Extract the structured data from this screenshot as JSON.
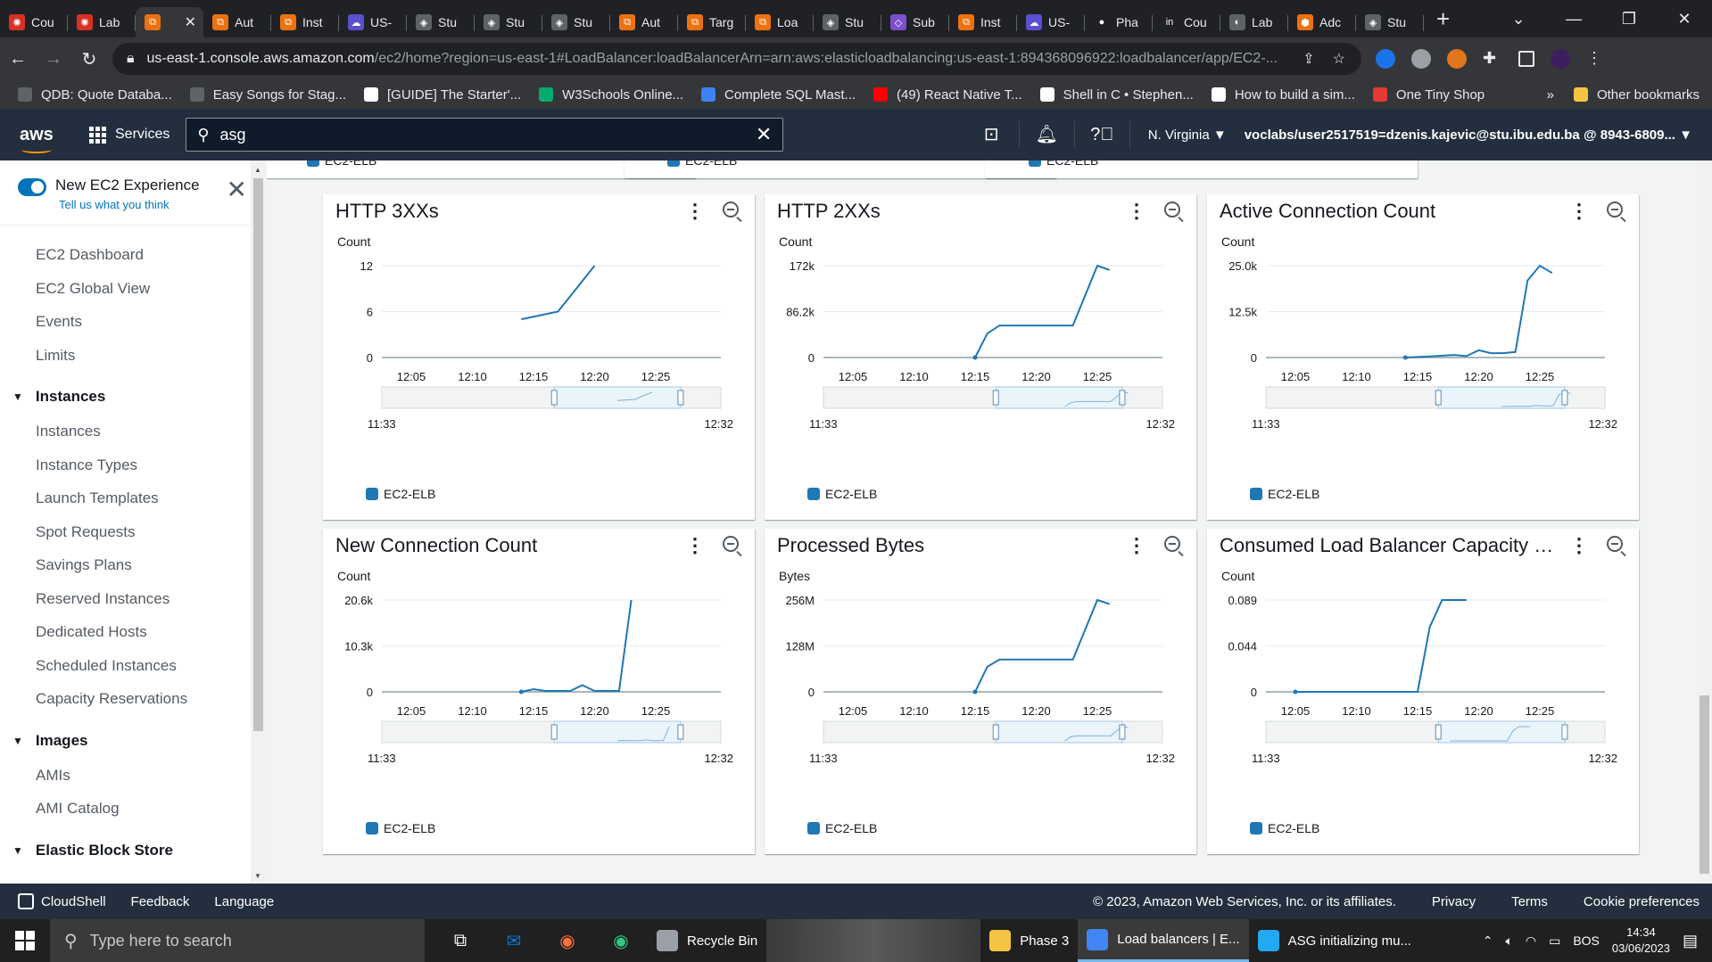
{
  "browser": {
    "tabs": [
      {
        "label": "Cou",
        "color": "#d93025",
        "glyph": "✺"
      },
      {
        "label": "Lab",
        "color": "#d93025",
        "glyph": "✺"
      },
      {
        "label": "",
        "color": "#ec7211",
        "glyph": "⧉",
        "active": true
      },
      {
        "label": "Aut",
        "color": "#ec7211",
        "glyph": "⧉"
      },
      {
        "label": "Inst",
        "color": "#ec7211",
        "glyph": "⧉"
      },
      {
        "label": "US-",
        "color": "#5a4fcf",
        "glyph": "☁"
      },
      {
        "label": "Stu",
        "color": "#5f6368",
        "glyph": "◈"
      },
      {
        "label": "Stu",
        "color": "#5f6368",
        "glyph": "◈"
      },
      {
        "label": "Stu",
        "color": "#5f6368",
        "glyph": "◈"
      },
      {
        "label": "Aut",
        "color": "#ec7211",
        "glyph": "⧉"
      },
      {
        "label": "Targ",
        "color": "#ec7211",
        "glyph": "⧉"
      },
      {
        "label": "Loa",
        "color": "#ec7211",
        "glyph": "⧉"
      },
      {
        "label": "Stu",
        "color": "#5f6368",
        "glyph": "◈"
      },
      {
        "label": "Sub",
        "color": "#7b4fcf",
        "glyph": "◇"
      },
      {
        "label": "Inst",
        "color": "#ec7211",
        "glyph": "⧉"
      },
      {
        "label": "US-",
        "color": "#5a4fcf",
        "glyph": "☁"
      },
      {
        "label": "Pha",
        "color": "#202124",
        "glyph": "●"
      },
      {
        "label": "Cou",
        "color": "#202124",
        "glyph": "in"
      },
      {
        "label": "Lab",
        "color": "#5f6368",
        "glyph": "◐"
      },
      {
        "label": "Adc",
        "color": "#ec7211",
        "glyph": "⬢"
      },
      {
        "label": "Stu",
        "color": "#5f6368",
        "glyph": "◈"
      }
    ],
    "url_host": "us-east-1.console.aws.amazon.com",
    "url_rest": "/ec2/home?region=us-east-1#LoadBalancer:loadBalancerArn=arn:aws:elasticloadbalancing:us-east-1:894368096922:loadbalancer/app/EC2-...",
    "bookmarks": [
      {
        "label": "QDB: Quote Databa...",
        "color": "#5f6368"
      },
      {
        "label": "Easy Songs for Stag...",
        "color": "#5f6368"
      },
      {
        "label": "[GUIDE] The Starter'...",
        "color": "#ffffff"
      },
      {
        "label": "W3Schools Online...",
        "color": "#04aa6d"
      },
      {
        "label": "Complete SQL Mast...",
        "color": "#3b82f6"
      },
      {
        "label": "(49) React Native T...",
        "color": "#ff0000"
      },
      {
        "label": "Shell in C • Stephen...",
        "color": "#ffffff"
      },
      {
        "label": "How to build a sim...",
        "color": "#ffffff"
      },
      {
        "label": "One Tiny Shop",
        "color": "#e53935"
      }
    ],
    "bookmarks_more": "»",
    "other_bookmarks": "Other bookmarks"
  },
  "aws": {
    "logo": "aws",
    "services_label": "Services",
    "search_value": "asg",
    "region": "N. Virginia",
    "account": "voclabs/user2517519=dzenis.kajevic@stu.ibu.edu.ba @ 8943-6809...",
    "accent": "#ff9900"
  },
  "sidebar": {
    "new_exp_title": "New EC2 Experience",
    "new_exp_link": "Tell us what you think",
    "top_items": [
      "EC2 Dashboard",
      "EC2 Global View",
      "Events",
      "Limits"
    ],
    "instances_section": "Instances",
    "instances_items": [
      "Instances",
      "Instance Types",
      "Launch Templates",
      "Spot Requests",
      "Savings Plans",
      "Reserved Instances",
      "Dedicated Hosts",
      "Scheduled Instances",
      "Capacity Reservations"
    ],
    "images_section": "Images",
    "images_items": [
      "AMIs",
      "AMI Catalog"
    ],
    "ebs_section": "Elastic Block Store"
  },
  "chart_data": [
    {
      "type": "line",
      "title": "HTTP 3XXs",
      "ylabel": "Count",
      "yticks": [
        "12",
        "6",
        "0"
      ],
      "ylim": [
        0,
        12
      ],
      "xticks": [
        "12:05",
        "12:10",
        "12:15",
        "12:20",
        "12:25"
      ],
      "x": [
        "12:14",
        "12:17",
        "12:20"
      ],
      "values": [
        5,
        6,
        12
      ],
      "nav_start": "11:33",
      "nav_end": "12:32",
      "legend": "EC2-ELB"
    },
    {
      "type": "line",
      "title": "HTTP 2XXs",
      "ylabel": "Count",
      "yticks": [
        "172k",
        "86.2k",
        "0"
      ],
      "ylim": [
        0,
        172000
      ],
      "xticks": [
        "12:05",
        "12:10",
        "12:15",
        "12:20",
        "12:25"
      ],
      "x": [
        "12:15",
        "12:16",
        "12:17",
        "12:23",
        "12:25",
        "12:26"
      ],
      "values": [
        0,
        45000,
        60000,
        60000,
        172000,
        164000
      ],
      "nav_start": "11:33",
      "nav_end": "12:32",
      "legend": "EC2-ELB"
    },
    {
      "type": "line",
      "title": "Active Connection Count",
      "ylabel": "Count",
      "yticks": [
        "25.0k",
        "12.5k",
        "0"
      ],
      "ylim": [
        0,
        25000
      ],
      "xticks": [
        "12:05",
        "12:10",
        "12:15",
        "12:20",
        "12:25"
      ],
      "x": [
        "12:14",
        "12:16",
        "12:18",
        "12:19",
        "12:20",
        "12:21",
        "12:22",
        "12:23",
        "12:24",
        "12:25",
        "12:26"
      ],
      "values": [
        0,
        300,
        700,
        400,
        2000,
        1200,
        1200,
        1500,
        21000,
        25000,
        23000
      ],
      "nav_start": "11:33",
      "nav_end": "12:32",
      "legend": "EC2-ELB"
    },
    {
      "type": "line",
      "title": "New Connection Count",
      "ylabel": "Count",
      "yticks": [
        "20.6k",
        "10.3k",
        "0"
      ],
      "ylim": [
        0,
        20600
      ],
      "xticks": [
        "12:05",
        "12:10",
        "12:15",
        "12:20",
        "12:25"
      ],
      "x": [
        "12:14",
        "12:15",
        "12:16",
        "12:18",
        "12:19",
        "12:20",
        "12:22",
        "12:23"
      ],
      "values": [
        0,
        600,
        200,
        200,
        1500,
        200,
        200,
        20600
      ],
      "nav_start": "11:33",
      "nav_end": "12:32",
      "legend": "EC2-ELB"
    },
    {
      "type": "line",
      "title": "Processed Bytes",
      "ylabel": "Bytes",
      "yticks": [
        "256M",
        "128M",
        "0"
      ],
      "ylim": [
        0,
        256000000
      ],
      "xticks": [
        "12:05",
        "12:10",
        "12:15",
        "12:20",
        "12:25"
      ],
      "x": [
        "12:15",
        "12:16",
        "12:17",
        "12:23",
        "12:25",
        "12:26"
      ],
      "values": [
        0,
        70000000,
        90000000,
        90000000,
        256000000,
        245000000
      ],
      "nav_start": "11:33",
      "nav_end": "12:32",
      "legend": "EC2-ELB"
    },
    {
      "type": "line",
      "title": "Consumed Load Balancer Capacity U...",
      "ylabel": "Count",
      "yticks": [
        "0.089",
        "0.044",
        "0"
      ],
      "ylim": [
        0,
        0.089
      ],
      "xticks": [
        "12:05",
        "12:10",
        "12:15",
        "12:20",
        "12:25"
      ],
      "x": [
        "12:05",
        "12:15",
        "12:16",
        "12:17",
        "12:19"
      ],
      "values": [
        0,
        0,
        0.063,
        0.089,
        0.089
      ],
      "nav_start": "11:33",
      "nav_end": "12:32",
      "legend": "EC2-ELB"
    }
  ],
  "series_color": "#1f77b4",
  "top_legend": "EC2-ELB",
  "footer": {
    "cloudshell": "CloudShell",
    "feedback": "Feedback",
    "language": "Language",
    "copyright": "© 2023, Amazon Web Services, Inc. or its affiliates.",
    "privacy": "Privacy",
    "terms": "Terms",
    "cookies": "Cookie preferences"
  },
  "taskbar": {
    "search_placeholder": "Type here to search",
    "apps": [
      {
        "label": "Recycle Bin",
        "color": "#9aa0a6"
      },
      {
        "label": "Phase 3",
        "color": "#f4c542"
      },
      {
        "label": "Load balancers | E...",
        "color": "#4285f4",
        "active": true
      },
      {
        "label": "ASG initializing mu...",
        "color": "#23a9f2"
      }
    ],
    "lang": "BOS",
    "time": "14:34",
    "date": "03/06/2023"
  }
}
